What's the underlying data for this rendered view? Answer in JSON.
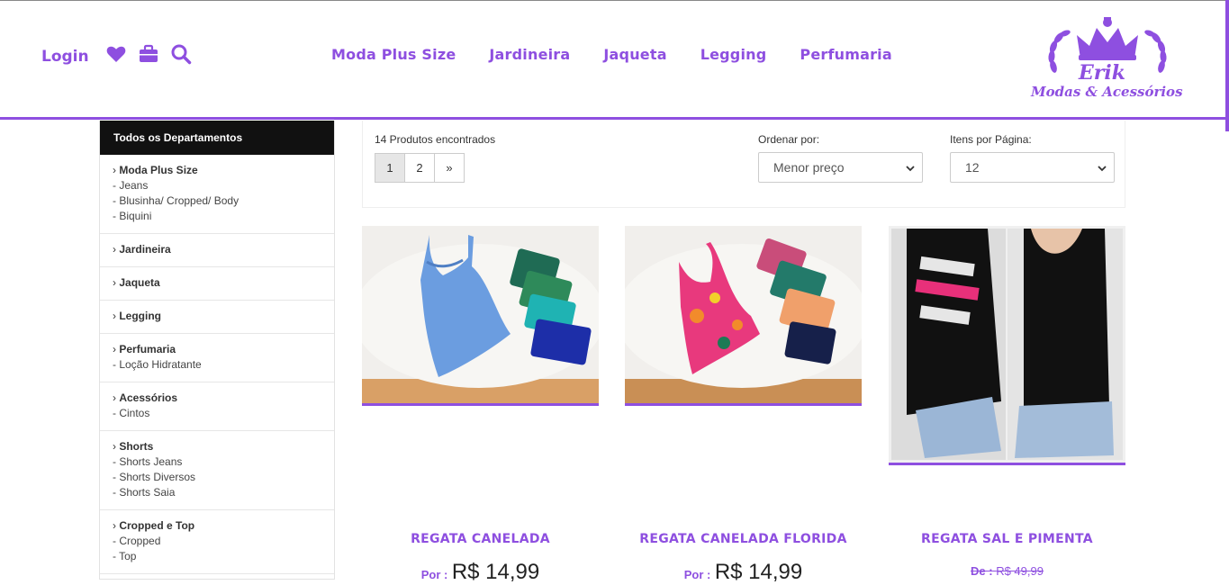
{
  "header": {
    "login_label": "Login",
    "icons": [
      "heart-icon",
      "bag-icon",
      "search-icon"
    ],
    "nav": [
      "Moda Plus Size",
      "Jardineira",
      "Jaqueta",
      "Legging",
      "Perfumaria"
    ],
    "logo_line1": "Erik",
    "logo_line2": "Modas & Acessórios",
    "accent": "#8e4fe0"
  },
  "sidebar": {
    "title": "Todos os Departamentos",
    "groups": [
      {
        "title": "Moda Plus Size",
        "items": [
          "- Jeans",
          "- Blusinha/ Cropped/ Body",
          "- Biquini"
        ]
      },
      {
        "title": "Jardineira",
        "items": []
      },
      {
        "title": "Jaqueta",
        "items": []
      },
      {
        "title": "Legging",
        "items": []
      },
      {
        "title": "Perfumaria",
        "items": [
          "- Loção Hidratante"
        ]
      },
      {
        "title": "Acessórios",
        "items": [
          "- Cintos"
        ]
      },
      {
        "title": "Shorts",
        "items": [
          "- Shorts Jeans",
          "- Shorts Diversos",
          "- Shorts Saia"
        ]
      },
      {
        "title": "Cropped e Top",
        "items": [
          "- Cropped",
          "- Top"
        ]
      }
    ]
  },
  "toolbar": {
    "found": "14 Produtos encontrados",
    "pages": [
      "1",
      "2",
      "»"
    ],
    "active_page": "1",
    "sort_label": "Ordenar por:",
    "sort_value": "Menor preço",
    "per_page_label": "Itens por Página:",
    "per_page_value": "12"
  },
  "products": [
    {
      "name": "REGATA CANELADA",
      "price_prefix": "Por :",
      "price": "R$ 14,99"
    },
    {
      "name": "REGATA CANELADA FLORIDA",
      "price_prefix": "Por :",
      "price": "R$ 14,99"
    },
    {
      "name": "REGATA SAL E PIMENTA",
      "old_prefix": "De :",
      "old_price": "R$ 49,99"
    }
  ]
}
